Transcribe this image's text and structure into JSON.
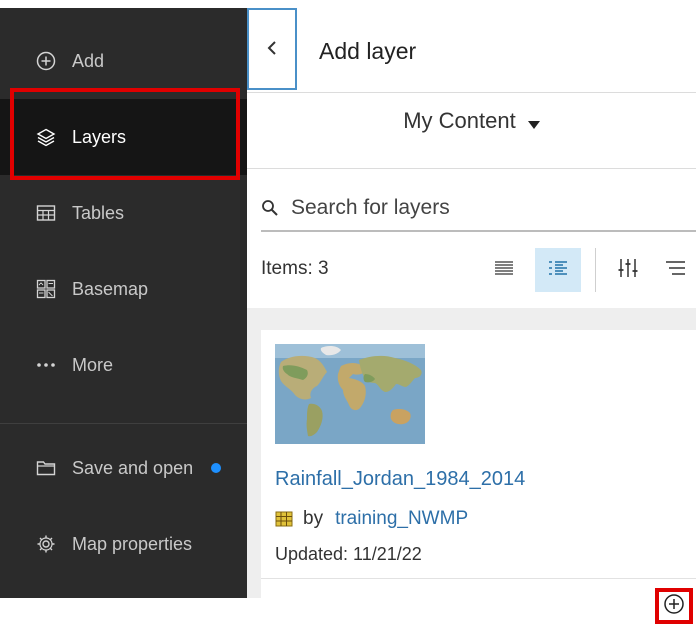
{
  "sidebar": {
    "items": [
      {
        "label": "Add",
        "icon": "plus-circle-icon"
      },
      {
        "label": "Layers",
        "icon": "layers-icon",
        "active": true
      },
      {
        "label": "Tables",
        "icon": "table-icon"
      },
      {
        "label": "Basemap",
        "icon": "basemap-icon"
      },
      {
        "label": "More",
        "icon": "more-icon"
      },
      {
        "label": "Save and open",
        "icon": "folder-icon",
        "indicator_color": "#1e90ff"
      },
      {
        "label": "Map properties",
        "icon": "gear-icon"
      }
    ]
  },
  "panel": {
    "title": "Add layer",
    "back_icon": "chevron-left-icon",
    "content_source": "My Content",
    "search": {
      "placeholder": "Search for layers",
      "value": ""
    },
    "items_count": "Items: 3",
    "view_buttons": [
      "list-icon",
      "detail-list-icon",
      "filter-icon",
      "sort-icon"
    ]
  },
  "results": [
    {
      "title": "Rainfall_Jordan_1984_2014",
      "by": "by",
      "owner": "training_NWMP",
      "updated": "Updated: 11/21/22",
      "item_type_icon": "feature-layer-icon",
      "add_icon": "plus-circle-icon"
    }
  ],
  "colors": {
    "sidebar_bg": "#2b2b2b",
    "active_bg": "#151515",
    "link": "#2d6fa8",
    "highlight": "#e00000",
    "selected_view": "#d3e9f7"
  }
}
